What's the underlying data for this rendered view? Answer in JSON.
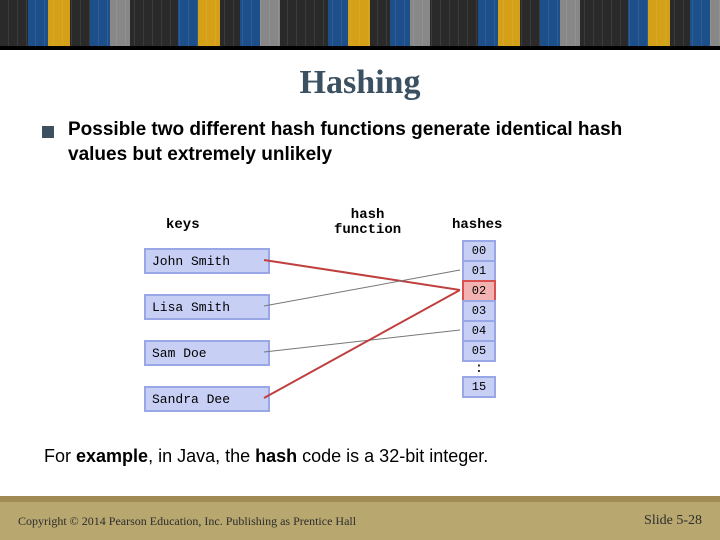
{
  "title": "Hashing",
  "bullet": "Possible two different hash functions generate identical hash values but extremely unlikely",
  "diagram": {
    "headers": {
      "keys": "keys",
      "func": "hash\nfunction",
      "hashes": "hashes"
    },
    "keys": [
      "John Smith",
      "Lisa Smith",
      "Sam Doe",
      "Sandra Dee"
    ],
    "hashes": [
      "00",
      "01",
      "02",
      "03",
      "04",
      "05"
    ],
    "highlight_index": 2,
    "vdots": ":",
    "hash_last": "15",
    "map": [
      {
        "key": 0,
        "hash": 2
      },
      {
        "key": 1,
        "hash": 1
      },
      {
        "key": 2,
        "hash": 4
      },
      {
        "key": 3,
        "hash": 2
      }
    ]
  },
  "example": {
    "pre": "For ",
    "bold1": "example",
    "mid": ", in Java, the ",
    "bold2": "hash",
    "post": " code is a 32-bit integer."
  },
  "footer": {
    "copyright": "Copyright © 2014 Pearson Education, Inc. Publishing as Prentice Hall",
    "slide": "Slide 5-28"
  }
}
